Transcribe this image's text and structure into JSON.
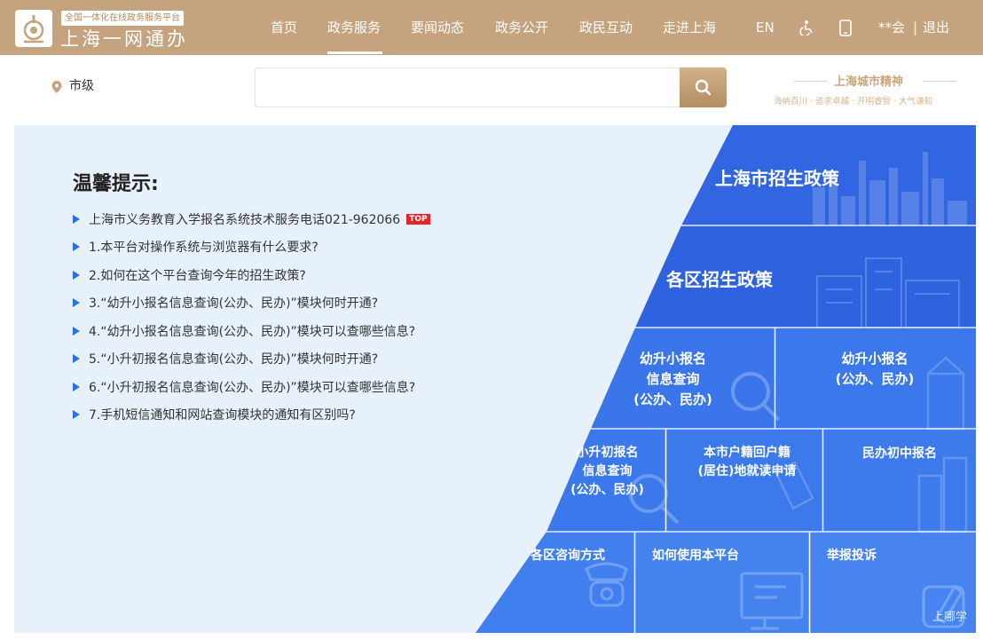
{
  "header": {
    "logo_tag": "全国一体化在线政务服务平台",
    "logo_title": "上海一网通办",
    "nav": [
      "首页",
      "政务服务",
      "要闻动态",
      "政务公开",
      "政民互动",
      "走进上海"
    ],
    "active_nav": "政务服务",
    "lang": "EN",
    "user": "**会",
    "divider": "|",
    "logout": "退出",
    "brand_color": "#c4a37e"
  },
  "search": {
    "location": "市级",
    "placeholder": "",
    "button_icon": "search-icon"
  },
  "slogan": {
    "title": "上海城市精神",
    "subtitle": "海纳百川 · 追求卓越 · 开明睿智 · 大气谦和"
  },
  "tips": {
    "title": "温馨提示:",
    "items": [
      "上海市义务教育入学报名系统技术服务电话021-962066",
      "1.本平台对操作系统与浏览器有什么要求?",
      "2.如何在这个平台查询今年的招生政策?",
      "3.“幼升小报名信息查询(公办、民办)”模块何时开通?",
      "4.“幼升小报名信息查询(公办、民办)”模块可以查哪些信息?",
      "5.“小升初报名信息查询(公办、民办)”模块何时开通?",
      "6.“小升初报名信息查询(公办、民办)”模块可以查哪些信息?",
      "7.手机短信通知和网站查询模块的通知有区别吗?"
    ],
    "badge": "TOP"
  },
  "tiles": {
    "city_policy": "上海市招生政策",
    "district_policy": "各区招生政策",
    "k2p_query": [
      "幼升小报名",
      "信息查询",
      "(公办、民办)"
    ],
    "k2p_apply": [
      "幼升小报名",
      "(公办、民办)"
    ],
    "p2m_query": [
      "小升初报名",
      "信息查询",
      "(公办、民办)"
    ],
    "hukou_apply": [
      "本市户籍回户籍",
      "(居住)地就读申请"
    ],
    "private_middle": "民办初中报名",
    "district_contact": "各区咨询方式",
    "how_to_use": "如何使用本平台",
    "report": "举报投诉",
    "watermark": "上哪学"
  }
}
